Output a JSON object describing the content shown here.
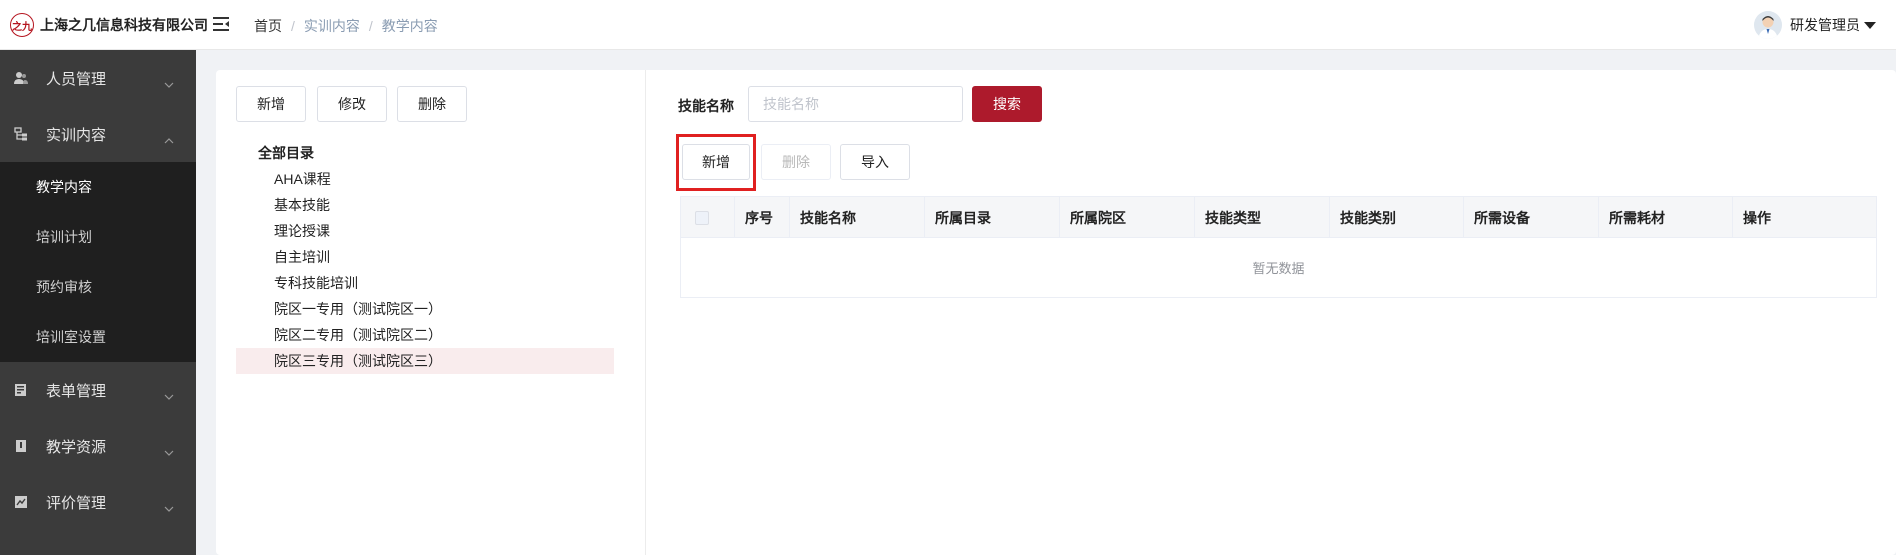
{
  "header": {
    "logo_mark": "之九",
    "company": "上海之几信息科技有限公司",
    "breadcrumb": [
      "首页",
      "实训内容",
      "教学内容"
    ],
    "user_name": "研发管理员"
  },
  "sidebar": {
    "items": [
      {
        "label": "人员管理",
        "icon": "users-icon",
        "expanded": false
      },
      {
        "label": "实训内容",
        "icon": "tree-icon",
        "expanded": true,
        "children": [
          {
            "label": "教学内容",
            "active": true
          },
          {
            "label": "培训计划"
          },
          {
            "label": "预约审核"
          },
          {
            "label": "培训室设置"
          }
        ]
      },
      {
        "label": "表单管理",
        "icon": "form-icon",
        "expanded": false
      },
      {
        "label": "教学资源",
        "icon": "book-icon",
        "expanded": false
      },
      {
        "label": "评价管理",
        "icon": "chart-icon",
        "expanded": false
      }
    ]
  },
  "left_toolbar": {
    "add": "新增",
    "edit": "修改",
    "delete": "删除"
  },
  "tree": {
    "root": "全部目录",
    "nodes": [
      "AHA课程",
      "基本技能",
      "理论授课",
      "自主培训",
      "专科技能培训",
      "院区一专用（测试院区一）",
      "院区二专用（测试院区二）",
      "院区三专用（测试院区三）"
    ],
    "selected_index": 7
  },
  "search": {
    "label": "技能名称",
    "placeholder": "技能名称",
    "value": "",
    "button": "搜索"
  },
  "table_toolbar": {
    "add": "新增",
    "delete": "删除",
    "import": "导入"
  },
  "table": {
    "columns": [
      "序号",
      "技能名称",
      "所属目录",
      "所属院区",
      "技能类型",
      "技能类别",
      "所需设备",
      "所需耗材",
      "操作"
    ],
    "empty_text": "暂无数据"
  },
  "colors": {
    "primary": "#ad1a2c",
    "sidebar_bg": "#3b3b3b",
    "submenu_bg": "#1f1f1f",
    "highlight": "#e02020"
  }
}
